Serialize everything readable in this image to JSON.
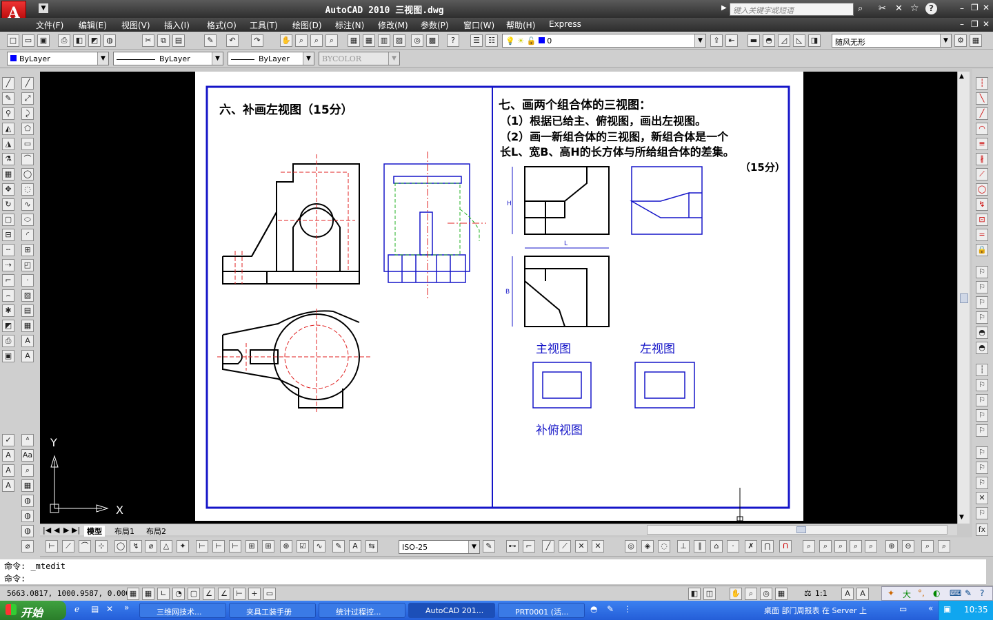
{
  "app": {
    "title": "AutoCAD 2010   三视图.dwg",
    "search_placeholder": "键入关键字或短语"
  },
  "menu": [
    "文件(F)",
    "编辑(E)",
    "视图(V)",
    "插入(I)",
    "格式(O)",
    "工具(T)",
    "绘图(D)",
    "标注(N)",
    "修改(M)",
    "参数(P)",
    "窗口(W)",
    "帮助(H)",
    "Express"
  ],
  "toolbar": {
    "layer_value": "0",
    "visual_style": "随风无形",
    "color": "ByLayer",
    "linetype": "ByLayer",
    "lineweight": "ByLayer",
    "plotstyle": "BYCOLOR",
    "dim_style": "ISO-25"
  },
  "drawing": {
    "q6_title": "六、补画左视图（15分）",
    "q7_title": "七、画两个组合体的三视图：",
    "q7_line1": "（1）根据已给主、俯视图，画出左视图。",
    "q7_line2": "（2）画一新组合体的三视图，新组合体是一个",
    "q7_line3": "长L、宽B、高H的长方体与所给组合体的差集。",
    "q7_score": "（15分）",
    "dim_H": "H",
    "dim_L": "L",
    "dim_B": "B",
    "label_front": "主视图",
    "label_left": "左视图",
    "label_top": "补俯视图"
  },
  "ucs": {
    "x": "X",
    "y": "Y"
  },
  "layout_tabs": [
    "模型",
    "布局1",
    "布局2"
  ],
  "command": {
    "line1": "命令:  _mtedit",
    "line2": "命令:"
  },
  "status": {
    "coords": "5663.0817, 1000.9587, 0.0000",
    "scale": "1:1"
  },
  "taskbar": {
    "start": "开始",
    "tasks": [
      "三维网技术...",
      "夹具工装手册",
      "统计过程控...",
      "AutoCAD 201...",
      "PRT0001 (活..."
    ],
    "tray_text": "桌面    部门周报表 在 Server 上",
    "clock": "10:35"
  }
}
